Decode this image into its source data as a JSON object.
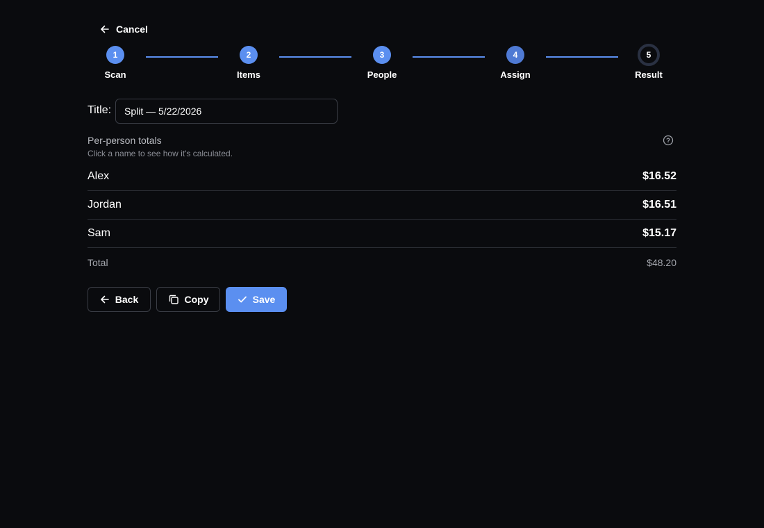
{
  "nav": {
    "cancel_label": "Cancel"
  },
  "stepper": {
    "steps": [
      {
        "number": "1",
        "label": "Scan",
        "state": "done"
      },
      {
        "number": "2",
        "label": "Items",
        "state": "done"
      },
      {
        "number": "3",
        "label": "People",
        "state": "done"
      },
      {
        "number": "4",
        "label": "Assign",
        "state": "done"
      },
      {
        "number": "5",
        "label": "Result",
        "state": "current"
      }
    ]
  },
  "form": {
    "title_label": "Title:",
    "title_value": "Split — 5/22/2026"
  },
  "totals": {
    "heading": "Per-person totals",
    "subheading": "Click a name to see how it's calculated.",
    "people": [
      {
        "name": "Alex",
        "amount": "$16.52"
      },
      {
        "name": "Jordan",
        "amount": "$16.51"
      },
      {
        "name": "Sam",
        "amount": "$15.17"
      }
    ],
    "total_label": "Total",
    "total_amount": "$48.20"
  },
  "actions": {
    "back_label": "Back",
    "copy_label": "Copy",
    "save_label": "Save"
  },
  "colors": {
    "accent": "#5b8ff0",
    "background": "#0a0b0e",
    "divider": "#2e3138"
  },
  "icons": {
    "cancel": "arrow-left-icon",
    "help": "question-circle-icon",
    "back": "arrow-left-icon",
    "copy": "copy-icon",
    "save": "check-icon"
  }
}
